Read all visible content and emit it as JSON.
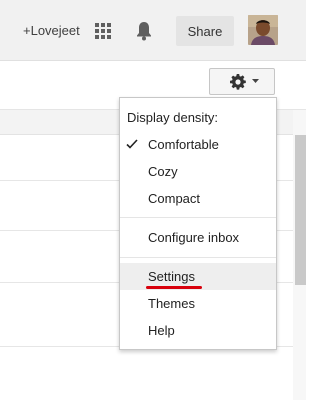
{
  "header": {
    "user_link": "+Lovejeet",
    "apps_icon": "apps-grid-icon",
    "notifications_icon": "bell-icon",
    "share_label": "Share"
  },
  "toolbar": {
    "settings_icon": "gear-icon",
    "dropdown_icon": "caret-down-icon"
  },
  "settings_menu": {
    "heading": "Display density:",
    "density_options": [
      "Comfortable",
      "Cozy",
      "Compact"
    ],
    "selected_density": "Comfortable",
    "configure_inbox": "Configure inbox",
    "settings": "Settings",
    "themes": "Themes",
    "help": "Help",
    "hovered_item": "Settings"
  },
  "colors": {
    "topbar_bg": "#f1f1f1",
    "hover_bg": "#eeeeee",
    "annotation_underline": "#d8000c"
  }
}
